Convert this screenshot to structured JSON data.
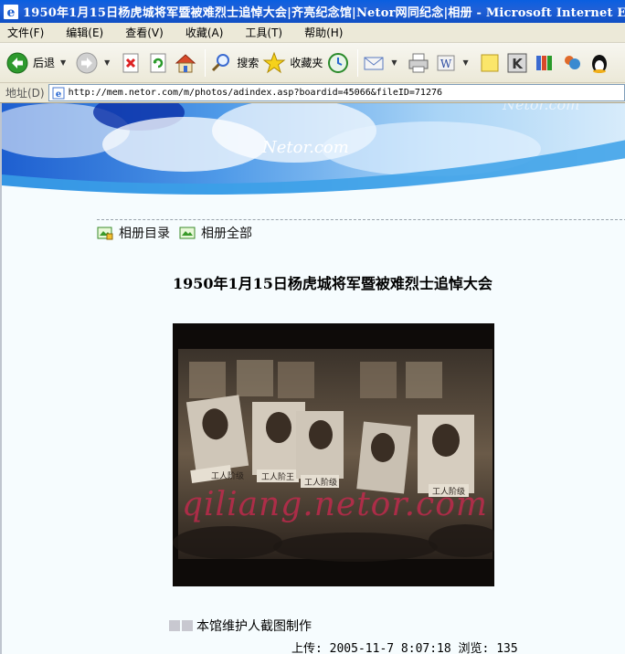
{
  "window": {
    "title": "1950年1月15日杨虎城将军暨被难烈士追悼大会|齐亮纪念馆|Netor网同纪念|相册 - Microsoft Internet Explorer"
  },
  "menu": [
    "文件(F)",
    "编辑(E)",
    "查看(V)",
    "收藏(A)",
    "工具(T)",
    "帮助(H)"
  ],
  "toolbar": {
    "back_label": "后退",
    "search_label": "搜索",
    "favorites_label": "收藏夹"
  },
  "address": {
    "label": "地址(D)",
    "url": "http://mem.netor.com/m/photos/adindex.asp?boardid=45066&fileID=71276"
  },
  "banner": {
    "logo_text": "Netor.com",
    "logo_text_faded": "Netor.com"
  },
  "album_links": {
    "catalog": "相册目录",
    "all": "相册全部"
  },
  "photo": {
    "title": "1950年1月15日杨虎城将军暨被难烈士追悼大会",
    "watermark": "qiliang.netor.com",
    "portrait_captions": [
      "工人阶级",
      "工人阶王",
      "工人阶级",
      "工人阶级"
    ]
  },
  "credit": {
    "text": "本馆维护人截图制作"
  },
  "upload": {
    "label": "上传:",
    "date": "2005-11-7 8:07:18",
    "views_label": "浏览:",
    "views": "135"
  }
}
